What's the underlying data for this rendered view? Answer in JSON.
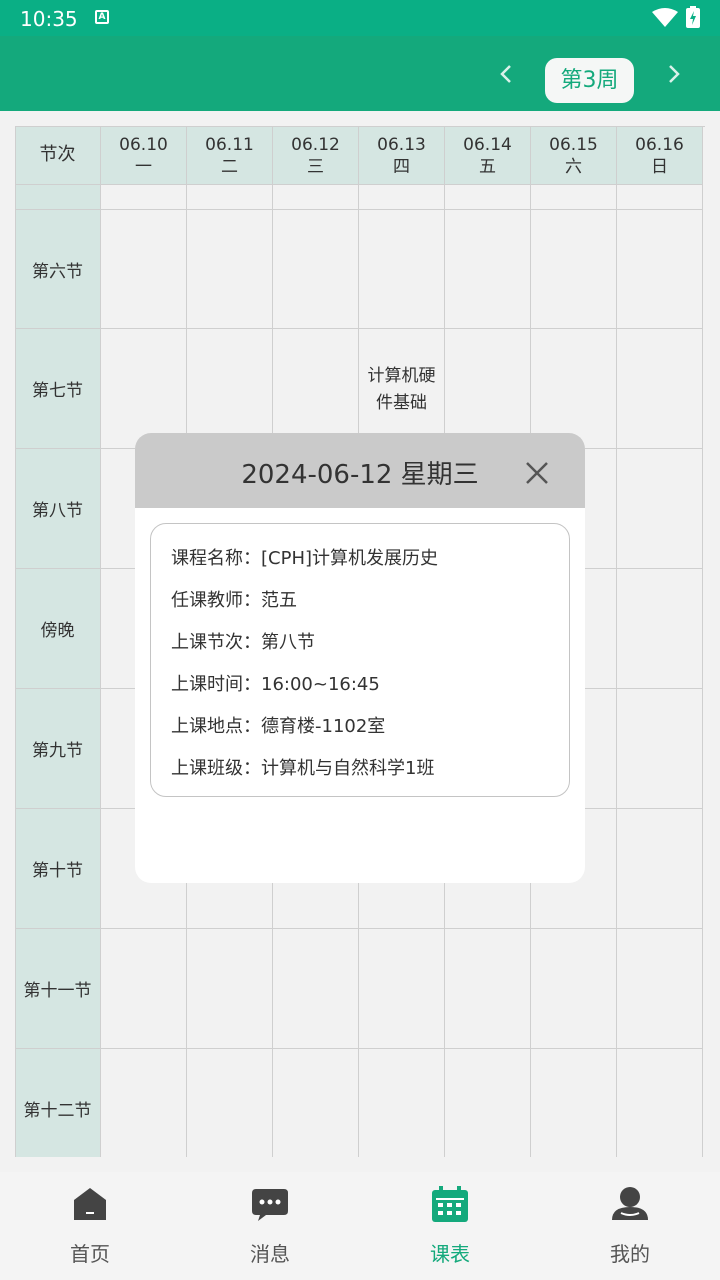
{
  "status_bar": {
    "time": "10:35",
    "a_icon": "A"
  },
  "header": {
    "week_label": "第3周",
    "prev_icon": "chevron-left-icon",
    "next_icon": "chevron-right-icon"
  },
  "timetable": {
    "corner_label": "节次",
    "days": [
      {
        "date": "06.10",
        "dow": "一"
      },
      {
        "date": "06.11",
        "dow": "二"
      },
      {
        "date": "06.12",
        "dow": "三"
      },
      {
        "date": "06.13",
        "dow": "四"
      },
      {
        "date": "06.14",
        "dow": "五"
      },
      {
        "date": "06.15",
        "dow": "六"
      },
      {
        "date": "06.16",
        "dow": "日"
      }
    ],
    "periods": [
      "",
      "第六节",
      "第七节",
      "第八节",
      "傍晚",
      "第九节",
      "第十节",
      "第十一节",
      "第十二节"
    ],
    "courses": [
      {
        "period_index": 2,
        "day_index": 3,
        "name": "计算机硬件基础"
      }
    ]
  },
  "dialog": {
    "title": "2024-06-12  星期三",
    "rows": [
      {
        "label": "课程名称：",
        "value": "[CPH]计算机发展历史"
      },
      {
        "label": "任课教师：",
        "value": "范五"
      },
      {
        "label": "上课节次：",
        "value": "第八节"
      },
      {
        "label": "上课时间：",
        "value": "16:00~16:45"
      },
      {
        "label": "上课地点：",
        "value": "德育楼-1102室"
      },
      {
        "label": "上课班级：",
        "value": "计算机与自然科学1班"
      }
    ]
  },
  "bottom_nav": {
    "items": [
      {
        "label": "首页",
        "icon": "home-icon"
      },
      {
        "label": "消息",
        "icon": "message-icon"
      },
      {
        "label": "课表",
        "icon": "calendar-icon"
      },
      {
        "label": "我的",
        "icon": "user-icon"
      }
    ],
    "active_index": 2
  },
  "colors": {
    "primary": "#14a97c",
    "status_bar": "#0aaf85",
    "header_cell": "#d5e6e2"
  }
}
